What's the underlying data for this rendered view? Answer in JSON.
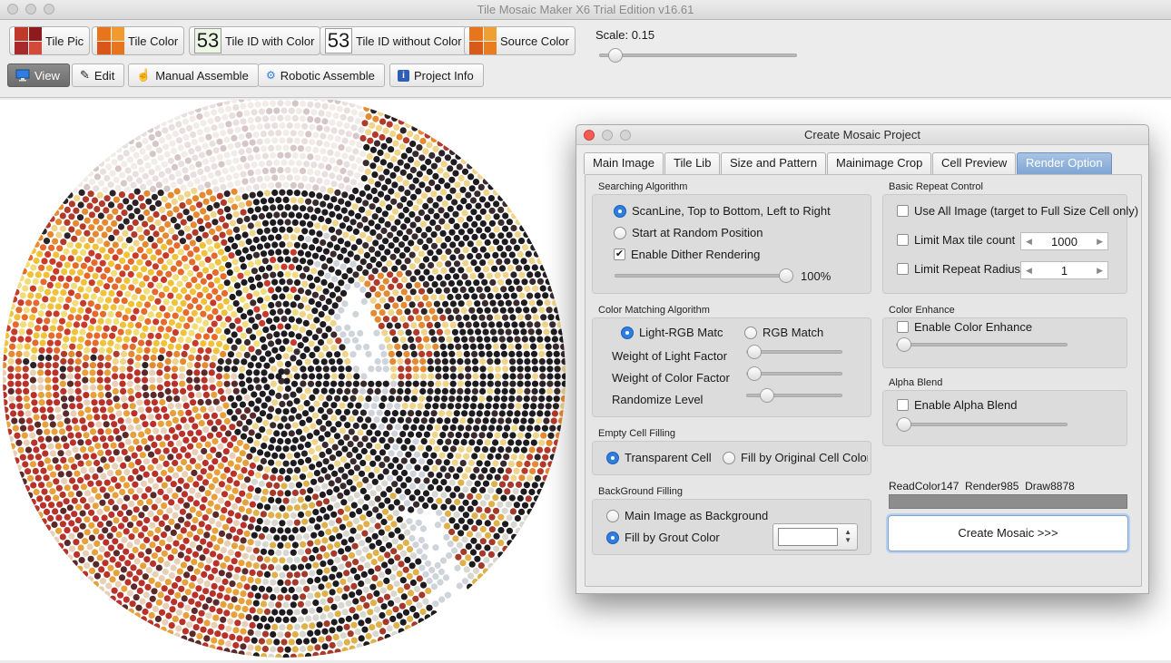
{
  "window": {
    "title": "Tile Mosaic Maker X6 Trial Edition v16.61"
  },
  "toolbar": {
    "buttons": [
      {
        "label": "Tile Pic"
      },
      {
        "label": "Tile Color"
      },
      {
        "label": "Tile ID with Color",
        "number": "53"
      },
      {
        "label": "Tile ID without Color",
        "number": "53"
      },
      {
        "label": "Source Color"
      }
    ],
    "scale_label": "Scale: 0.15",
    "scale_value": 0.15
  },
  "modes": [
    {
      "label": "View",
      "active": true
    },
    {
      "label": "Edit"
    },
    {
      "label": "Manual Assemble"
    },
    {
      "label": "Robotic Assemble"
    },
    {
      "label": "Project Info"
    }
  ],
  "dialog": {
    "title": "Create Mosaic Project",
    "tabs": [
      {
        "label": "Main Image"
      },
      {
        "label": "Tile Lib"
      },
      {
        "label": "Size and Pattern"
      },
      {
        "label": "Mainimage Crop"
      },
      {
        "label": "Cell Preview"
      },
      {
        "label": "Render Option",
        "active": true
      }
    ],
    "searching": {
      "title": "Searching Algorithm",
      "opt_scanline": "ScanLine, Top to Bottom, Left to Right",
      "opt_random": "Start at Random Position",
      "dither_label": "Enable Dither Rendering",
      "dither_percent": "100%",
      "dither_value": 1.0
    },
    "color_matching": {
      "title": "Color Matching Algorithm",
      "opt_light": "Light-RGB Matc",
      "opt_rgb": "RGB Match",
      "light_factor_label": "Weight of Light Factor",
      "color_factor_label": "Weight of Color Factor",
      "randomize_label": "Randomize Level",
      "light_factor_value": 0.08,
      "color_factor_value": 0.08,
      "randomize_value": 0.22
    },
    "empty_cell": {
      "title": "Empty Cell Filling",
      "opt_transparent": "Transparent Cell",
      "opt_original": "Fill by Original Cell Color"
    },
    "background": {
      "title": "BackGround Filling",
      "opt_main": "Main Image as Background",
      "opt_grout": "Fill by Grout Color"
    },
    "repeat": {
      "title": "Basic Repeat Control",
      "use_all_label": "Use All Image (target to Full Size Cell only)",
      "limit_max_label": "Limit Max tile count",
      "limit_max_value": "1000",
      "limit_radius_label": "Limit Repeat Radius",
      "limit_radius_value": "1"
    },
    "color_enhance": {
      "title": "Color Enhance",
      "label": "Enable Color Enhance",
      "value": 0.0
    },
    "alpha_blend": {
      "title": "Alpha Blend",
      "label": "Enable Alpha Blend",
      "value": 0.0
    },
    "status_text": "ReadColor147  Render985  Draw8878",
    "create_button": "Create Mosaic >>>"
  },
  "icons": {
    "view": "monitor-icon",
    "edit": "pencil-icon",
    "manual": "hand-icon",
    "robotic": "robot-arm-icon",
    "info": "info-icon"
  },
  "colors": {
    "accent_blue": "#2f7de1",
    "active_tab": "#7ea5d4",
    "view_active": "#6c6c6c"
  }
}
